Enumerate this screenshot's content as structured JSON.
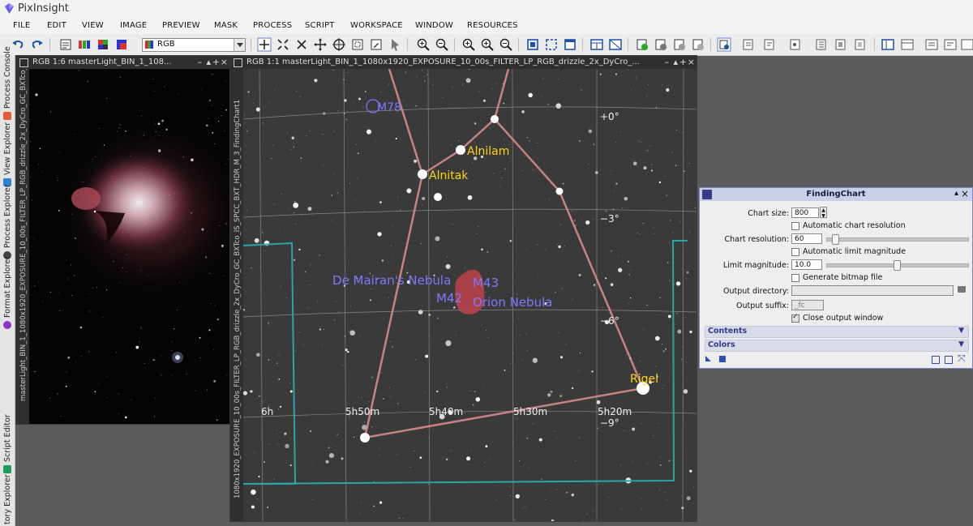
{
  "app": {
    "title": "PixInsight"
  },
  "menu": [
    "FILE",
    "EDIT",
    "VIEW",
    "IMAGE",
    "PREVIEW",
    "MASK",
    "PROCESS",
    "SCRIPT",
    "WORKSPACE",
    "WINDOW",
    "RESOURCES"
  ],
  "toolbar": {
    "color_mode": "RGB"
  },
  "left_dock": {
    "tabs": [
      "Process Console",
      "View Explorer",
      "Process Explorer",
      "Format Explorer",
      "Script Editor",
      "tory Explorer"
    ]
  },
  "window1": {
    "title": "RGB 1:6 masterLight_BIN_1_108...",
    "side_label": "masterLight_BIN_1_1080x1920_EXPOSURE_10_00s_FILTER_LP_RGB_drizzle_2x_DyCro_GC_BXTco_IS_SPCC_BXT_HDR_M_3"
  },
  "window2": {
    "title": "RGB 1:1 masterLight_BIN_1_1080x1920_EXPOSURE_10_00s_FILTER_LP_RGB_drizzle_2x_DyCro_...",
    "side_label": "1080x1920_EXPOSURE_10_00s_FILTER_LP_RGB_drizzle_2x_DyCro_GC_BXTco_IS_SPCC_BXT_HDR_M_3_FindingChart1"
  },
  "finding_chart": {
    "stars": [
      "Alnilam",
      "Alnitak",
      "Rigel"
    ],
    "objects": [
      "M78",
      "De Mairan's Nebula",
      "M43",
      "M42",
      "Orion Nebula"
    ],
    "declination_labels": [
      "+0°",
      "−3°",
      "−6°",
      "−9°"
    ],
    "ra_labels": [
      "6h",
      "5h50m",
      "5h40m",
      "5h30m",
      "5h20m"
    ],
    "colors": {
      "star_label": "#ffd21a",
      "object_label": "#7f78ff",
      "constellation": "#e08f8f",
      "boundary": "#2aa5a5"
    }
  },
  "panel": {
    "title": "FindingChart",
    "chart_size_label": "Chart size:",
    "chart_size_value": "800",
    "auto_resolution_label": "Automatic chart resolution",
    "chart_resolution_label": "Chart resolution:",
    "chart_resolution_value": "60",
    "auto_magnitude_label": "Automatic limit magnitude",
    "limit_magnitude_label": "Limit magnitude:",
    "limit_magnitude_value": "10.0",
    "bitmap_label": "Generate bitmap file",
    "output_dir_label": "Output directory:",
    "output_dir_value": "",
    "output_suffix_label": "Output suffix:",
    "output_suffix_value": "_fc",
    "close_label": "Close output window",
    "sections": [
      "Contents",
      "Colors"
    ]
  }
}
